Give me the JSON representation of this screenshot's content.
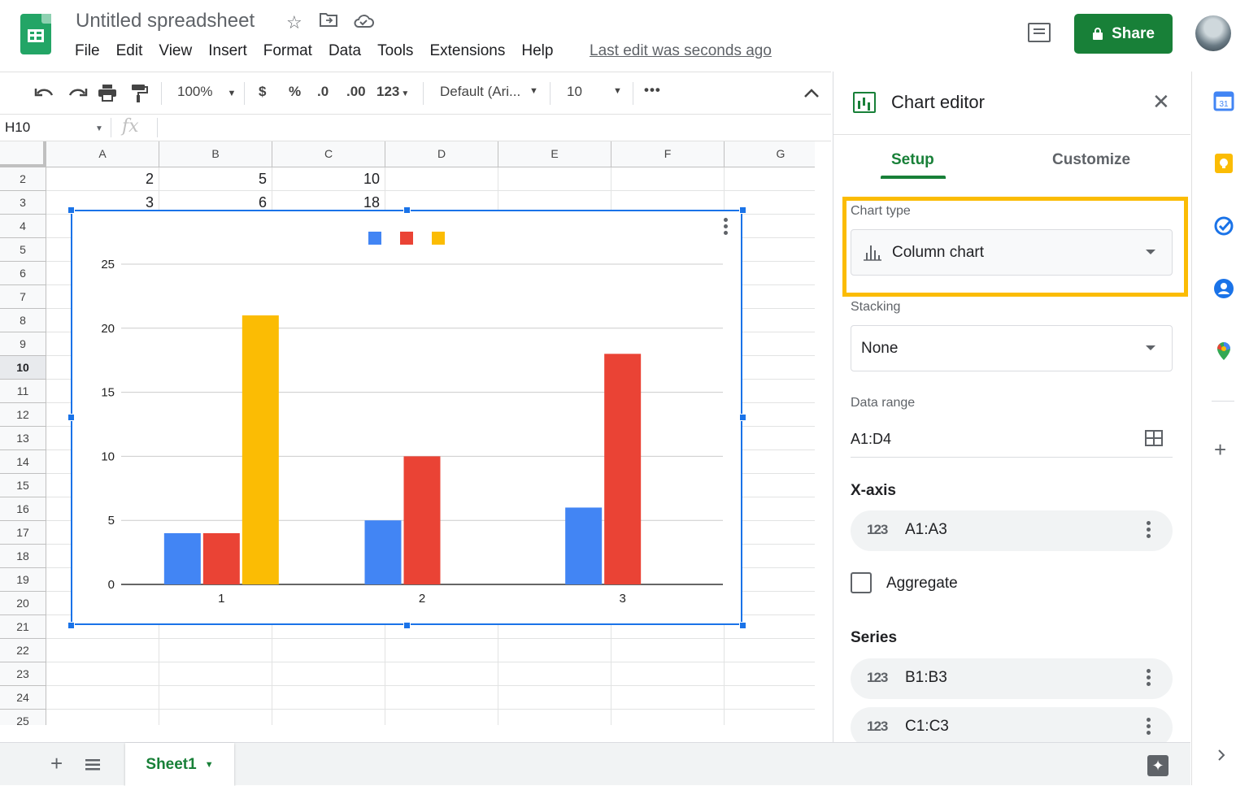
{
  "header": {
    "doc_title": "Untitled spreadsheet",
    "menu": [
      "File",
      "Edit",
      "View",
      "Insert",
      "Format",
      "Data",
      "Tools",
      "Extensions",
      "Help"
    ],
    "last_edit": "Last edit was seconds ago",
    "share_label": "Share",
    "icons": [
      "star-icon",
      "move-to-folder-icon",
      "cloud-status-icon",
      "comment-history-icon",
      "lock-icon"
    ]
  },
  "toolbar": {
    "zoom": "100%",
    "currency": "$",
    "percent": "%",
    "decrease_decimal": ".0",
    "increase_decimal": ".00",
    "more_formats": "123",
    "font": "Default (Ari...",
    "font_size": "10",
    "more": "•••"
  },
  "formula_bar": {
    "name_box": "H10",
    "fx": "fx"
  },
  "grid": {
    "columns": [
      "A",
      "B",
      "C",
      "D",
      "E",
      "F",
      "G"
    ],
    "rows": [
      "2",
      "3",
      "4",
      "5",
      "6",
      "7",
      "8",
      "9",
      "10",
      "11",
      "12",
      "13",
      "14",
      "15",
      "16",
      "17",
      "18",
      "19",
      "20",
      "21",
      "22",
      "23",
      "24",
      "25"
    ],
    "selected_row": "10",
    "cells": [
      [
        "2",
        "5",
        "10"
      ],
      [
        "3",
        "6",
        "18"
      ]
    ]
  },
  "chart_data": {
    "type": "bar",
    "categories": [
      "1",
      "2",
      "3"
    ],
    "series": [
      {
        "values": [
          4,
          5,
          6
        ],
        "color": "#4285f4"
      },
      {
        "values": [
          4,
          10,
          18
        ],
        "color": "#ea4335"
      },
      {
        "values": [
          21,
          null,
          null
        ],
        "color": "#fbbc04"
      }
    ],
    "title": "",
    "xlabel": "",
    "ylabel": "",
    "ylim": [
      0,
      25
    ],
    "yticks": [
      "0",
      "5",
      "10",
      "15",
      "20",
      "25"
    ],
    "grid": true,
    "legend_position": "top"
  },
  "sheets": {
    "active": "Sheet1"
  },
  "editor": {
    "title": "Chart editor",
    "tabs": [
      "Setup",
      "Customize"
    ],
    "chart_type_label": "Chart type",
    "chart_type_value": "Column chart",
    "stacking_label": "Stacking",
    "stacking_value": "None",
    "data_range_label": "Data range",
    "data_range_value": "A1:D4",
    "xaxis_heading": "X-axis",
    "xaxis_range": "A1:A3",
    "aggregate_label": "Aggregate",
    "series_heading": "Series",
    "series": [
      "B1:B3",
      "C1:C3"
    ],
    "number_badge": "123"
  },
  "colors": {
    "brand_green": "#188038",
    "selection_blue": "#1a73e8",
    "highlight_yellow": "#fbbc04"
  }
}
